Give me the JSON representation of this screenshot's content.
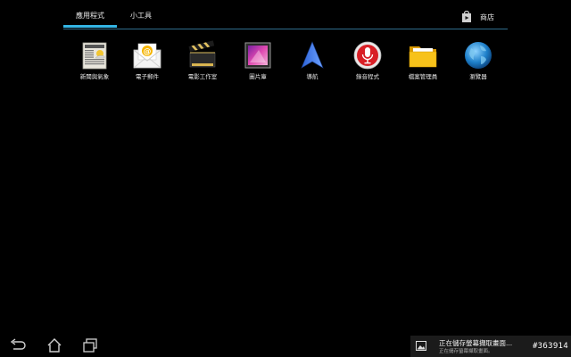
{
  "tabs": {
    "apps": "應用程式",
    "widgets": "小工具",
    "active": "apps"
  },
  "store": {
    "label": "商店",
    "icon": "play-store-icon"
  },
  "accent_color": "#33b5e5",
  "apps": [
    {
      "id": "news-weather",
      "label": "新聞與氣象",
      "icon": "newspaper-icon"
    },
    {
      "id": "email",
      "label": "電子郵件",
      "icon": "email-envelope-icon"
    },
    {
      "id": "movie-studio",
      "label": "電影工作室",
      "icon": "clapperboard-icon"
    },
    {
      "id": "gallery",
      "label": "圖片庫",
      "icon": "photo-gallery-icon"
    },
    {
      "id": "navigation",
      "label": "導航",
      "icon": "navigation-arrow-icon"
    },
    {
      "id": "sound-recorder",
      "label": "錄音程式",
      "icon": "microphone-icon"
    },
    {
      "id": "file-manager",
      "label": "檔案管理員",
      "icon": "folder-icon"
    },
    {
      "id": "browser",
      "label": "瀏覽器",
      "icon": "globe-icon"
    }
  ],
  "navbar": {
    "back": "back-icon",
    "home": "home-icon",
    "recents": "recent-apps-icon"
  },
  "notification": {
    "title": "正在儲存螢幕擷取畫面...",
    "subtitle": "正在儲存螢幕擷取畫面。",
    "icon": "image-icon"
  },
  "watermark": "#363914"
}
